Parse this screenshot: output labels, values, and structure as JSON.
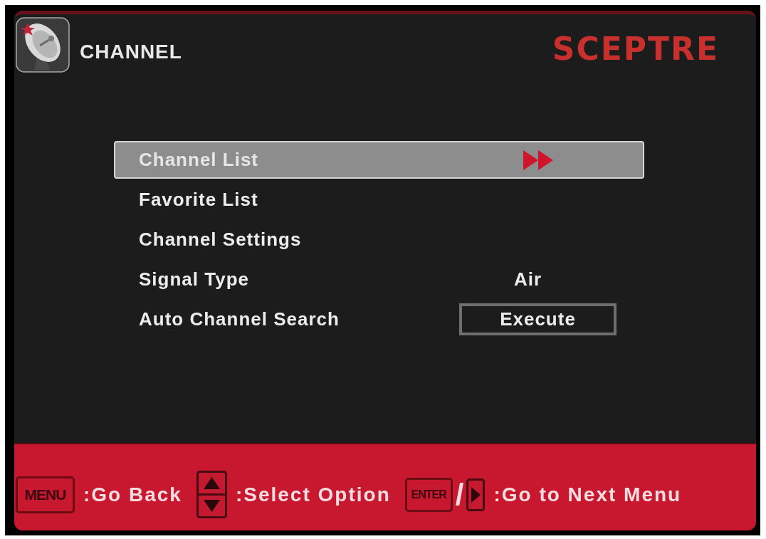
{
  "header": {
    "title": "CHANNEL",
    "logo": "SCEPTRE"
  },
  "menu": {
    "items": [
      {
        "label": "Channel List",
        "kind": "submenu",
        "selected": true
      },
      {
        "label": "Favorite List",
        "kind": "submenu",
        "selected": false
      },
      {
        "label": "Channel Settings",
        "kind": "submenu",
        "selected": false
      },
      {
        "label": "Signal Type",
        "kind": "value",
        "value": "Air",
        "selected": false
      },
      {
        "label": "Auto Channel Search",
        "kind": "action",
        "button": "Execute",
        "selected": false
      }
    ]
  },
  "footer": {
    "hints": [
      {
        "keys": [
          {
            "kind": "text",
            "label": "MENU"
          }
        ],
        "action": ":Go Back"
      },
      {
        "keys": [
          {
            "kind": "updown"
          }
        ],
        "action": ":Select Option"
      },
      {
        "keys": [
          {
            "kind": "text",
            "label": "ENTER"
          },
          {
            "kind": "separator",
            "label": "/"
          },
          {
            "kind": "right"
          }
        ],
        "action": ":Go to Next Menu"
      }
    ]
  }
}
